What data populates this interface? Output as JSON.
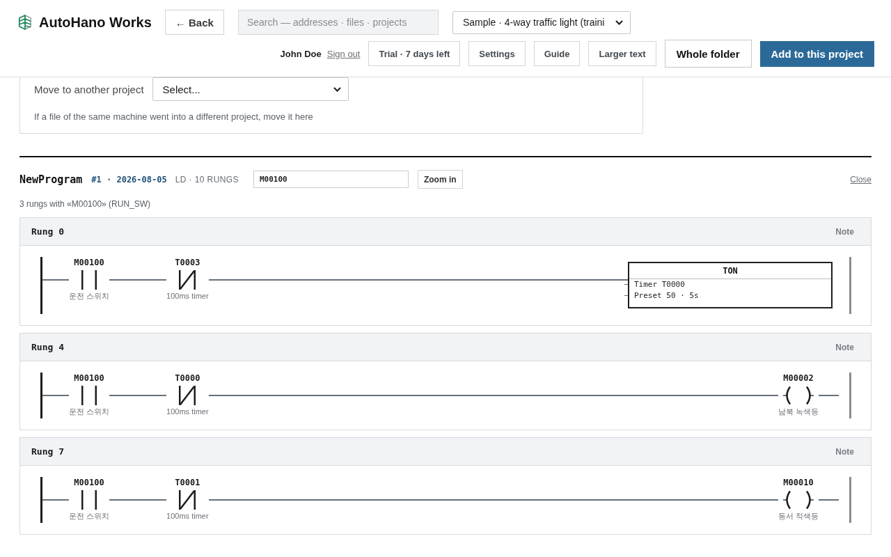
{
  "header": {
    "brand": "AutoHano Works",
    "back_button": "← Back",
    "search": {
      "placeholder": "Search — addresses · files · projects"
    },
    "project_select": {
      "value": "Sample · 4-way traffic light (traini"
    },
    "user": {
      "name": "John Doe",
      "sign_out": "Sign out"
    },
    "buttons": [
      {
        "label": "Trial · 7 days left",
        "kind": "plain"
      },
      {
        "label": "Settings",
        "kind": "plain"
      },
      {
        "label": "Guide",
        "kind": "plain"
      },
      {
        "label": "Larger text",
        "kind": "plain"
      },
      {
        "label": "Whole folder",
        "kind": "outline"
      },
      {
        "label": "Add to this project",
        "kind": "primary"
      }
    ]
  },
  "move_panel": {
    "label": "Move to another project",
    "select": {
      "value": "Select..."
    },
    "hint": "If a file of the same machine went into a different project, move it here"
  },
  "program": {
    "name": "NewProgram",
    "meta": "#1 · 2026-08-05",
    "info": "LD · 10 RUNGS",
    "filter": {
      "value": "M00100"
    },
    "zoom_button": "Zoom in",
    "close_link": "Close",
    "match_summary": "3 rungs with «M00100» (RUN_SW)"
  },
  "rungs": [
    {
      "title": "Rung 0",
      "note": "Note",
      "contacts": [
        {
          "kind": "no",
          "address": "M00100",
          "comment": "운전 스위치"
        },
        {
          "kind": "nc",
          "address": "T0003",
          "comment": "100ms timer"
        }
      ],
      "output": {
        "kind": "function_block",
        "name": "TON",
        "lines": [
          "Timer T0000",
          "Preset 50 · 5s"
        ]
      }
    },
    {
      "title": "Rung 4",
      "note": "Note",
      "contacts": [
        {
          "kind": "no",
          "address": "M00100",
          "comment": "운전 스위치"
        },
        {
          "kind": "nc",
          "address": "T0000",
          "comment": "100ms timer"
        }
      ],
      "output": {
        "kind": "coil",
        "address": "M00002",
        "comment": "남북 녹색등"
      }
    },
    {
      "title": "Rung 7",
      "note": "Note",
      "contacts": [
        {
          "kind": "no",
          "address": "M00100",
          "comment": "운전 스위치"
        },
        {
          "kind": "nc",
          "address": "T0001",
          "comment": "100ms timer"
        }
      ],
      "output": {
        "kind": "coil",
        "address": "M00010",
        "comment": "동서 적색등"
      }
    }
  ]
}
